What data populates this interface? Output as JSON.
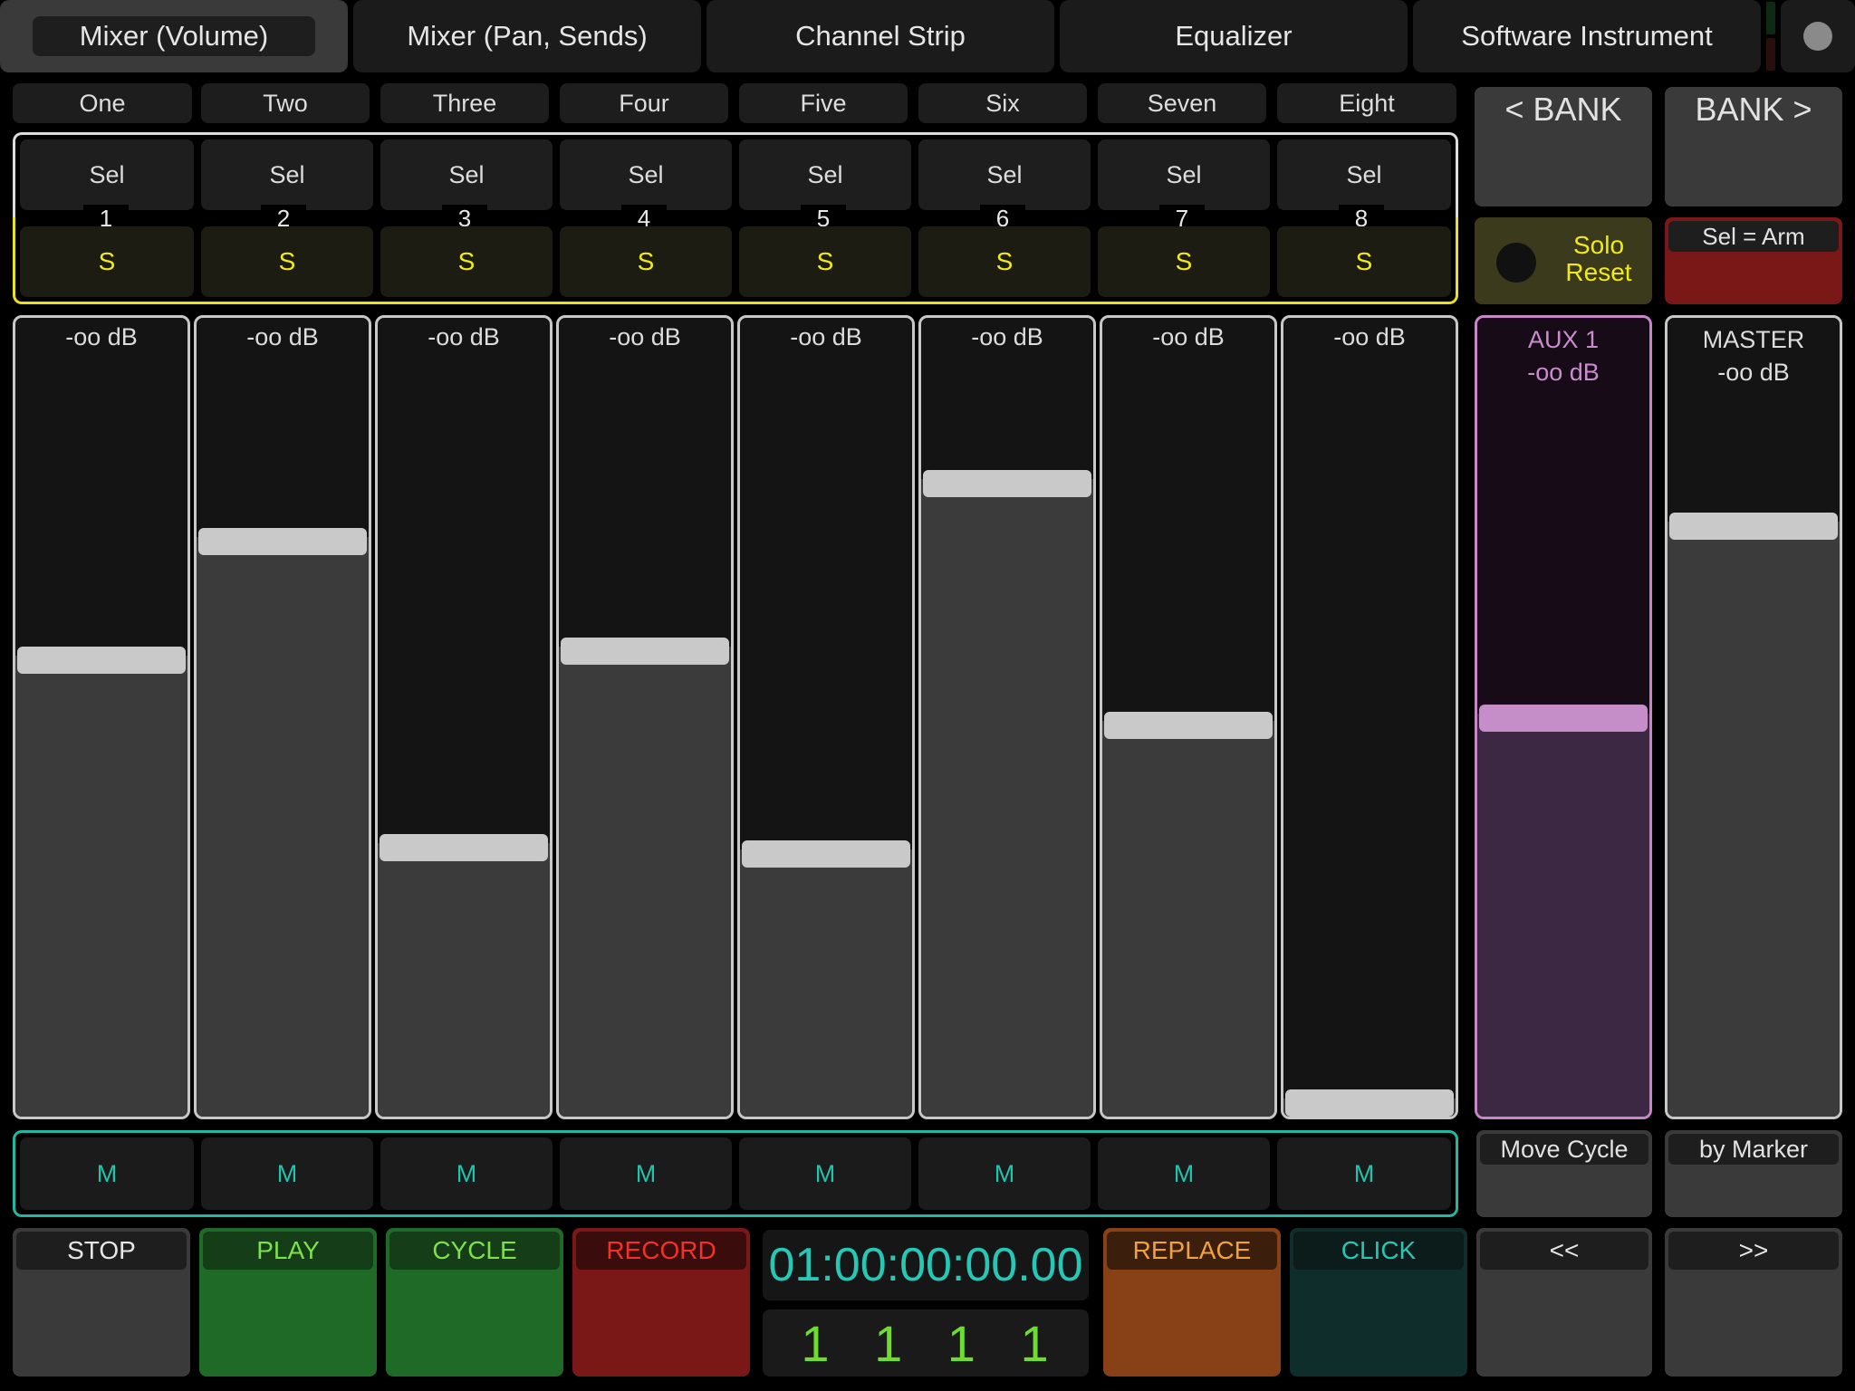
{
  "tabs": [
    {
      "label": "Mixer (Volume)",
      "active": true
    },
    {
      "label": "Mixer (Pan, Sends)",
      "active": false
    },
    {
      "label": "Channel Strip",
      "active": false
    },
    {
      "label": "Equalizer",
      "active": false
    },
    {
      "label": "Software Instrument",
      "active": false
    }
  ],
  "tracks": [
    {
      "name": "One",
      "sel": "Sel",
      "num": "1",
      "solo": "S",
      "db": "-oo dB",
      "level": 0.625,
      "mute": "M"
    },
    {
      "name": "Two",
      "sel": "Sel",
      "num": "2",
      "solo": "S",
      "db": "-oo dB",
      "level": 0.793,
      "mute": "M"
    },
    {
      "name": "Three",
      "sel": "Sel",
      "num": "3",
      "solo": "S",
      "db": "-oo dB",
      "level": 0.36,
      "mute": "M"
    },
    {
      "name": "Four",
      "sel": "Sel",
      "num": "4",
      "solo": "S",
      "db": "-oo dB",
      "level": 0.638,
      "mute": "M"
    },
    {
      "name": "Five",
      "sel": "Sel",
      "num": "5",
      "solo": "S",
      "db": "-oo dB",
      "level": 0.352,
      "mute": "M"
    },
    {
      "name": "Six",
      "sel": "Sel",
      "num": "6",
      "solo": "S",
      "db": "-oo dB",
      "level": 0.875,
      "mute": "M"
    },
    {
      "name": "Seven",
      "sel": "Sel",
      "num": "7",
      "solo": "S",
      "db": "-oo dB",
      "level": 0.533,
      "mute": "M"
    },
    {
      "name": "Eight",
      "sel": "Sel",
      "num": "8",
      "solo": "S",
      "db": "-oo dB",
      "level": 0.0,
      "mute": "M"
    }
  ],
  "bank": {
    "prev": "< BANK",
    "next": "BANK >"
  },
  "solo_reset": {
    "line1": "Solo",
    "line2": "Reset"
  },
  "sel_arm": "Sel = Arm",
  "aux": {
    "name": "AUX 1",
    "db": "-oo dB",
    "level": 0.543
  },
  "master": {
    "name": "MASTER",
    "db": "-oo dB",
    "level": 0.814
  },
  "move_cycle": "Move Cycle",
  "by_marker": "by Marker",
  "transport": {
    "stop": "STOP",
    "play": "PLAY",
    "cycle": "CYCLE",
    "record": "RECORD",
    "replace": "REPLACE",
    "click": "CLICK",
    "rewind": "<<",
    "forward": ">>",
    "timecode": "01:00:00:00.00",
    "bars": "1 1 1 1"
  },
  "colors": {
    "solo_yellow": "#e8e21c",
    "mute_teal": "#1fb8a3",
    "aux_purple": "#c686c8",
    "play_green": "#1f6a26",
    "record_red": "#7a1818",
    "replace_orange": "#884017",
    "click_teal": "#0f2d2a"
  }
}
